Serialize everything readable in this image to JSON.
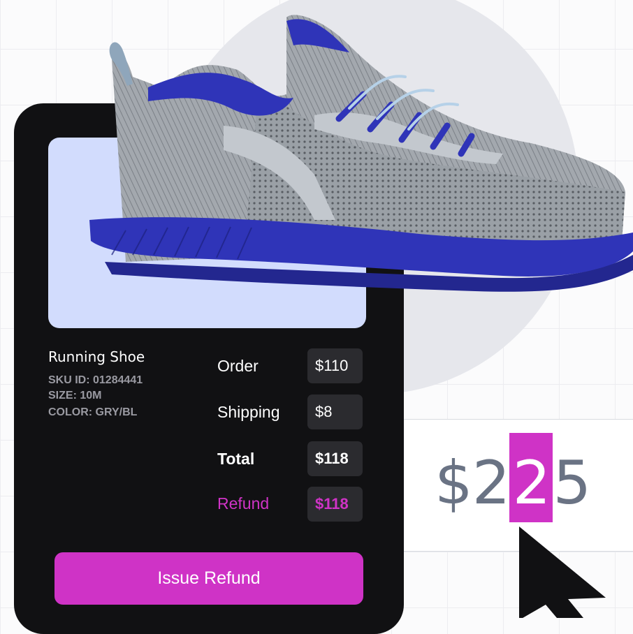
{
  "product": {
    "name": "Running Shoe",
    "sku": "SKU ID: 01284441",
    "size": "SIZE: 10M",
    "color": "COLOR: GRY/BL"
  },
  "summary": [
    {
      "label": "Order",
      "value": "$110"
    },
    {
      "label": "Shipping",
      "value": "$8"
    },
    {
      "label": "Total",
      "value": "$118"
    },
    {
      "label": "Refund",
      "value": "$118"
    }
  ],
  "action": {
    "issue_refund_label": "Issue Refund"
  },
  "amount_editor": {
    "before_selection": "$2",
    "selected": "2",
    "after_selection": "5"
  },
  "colors": {
    "accent": "#cf33c6",
    "card": "#111113",
    "image_panel": "#d2dcfd",
    "shoe_sole": "#2f34b8"
  },
  "icons": {
    "cursor": "mouse-pointer-icon",
    "product_photo": "running-shoe-image"
  }
}
